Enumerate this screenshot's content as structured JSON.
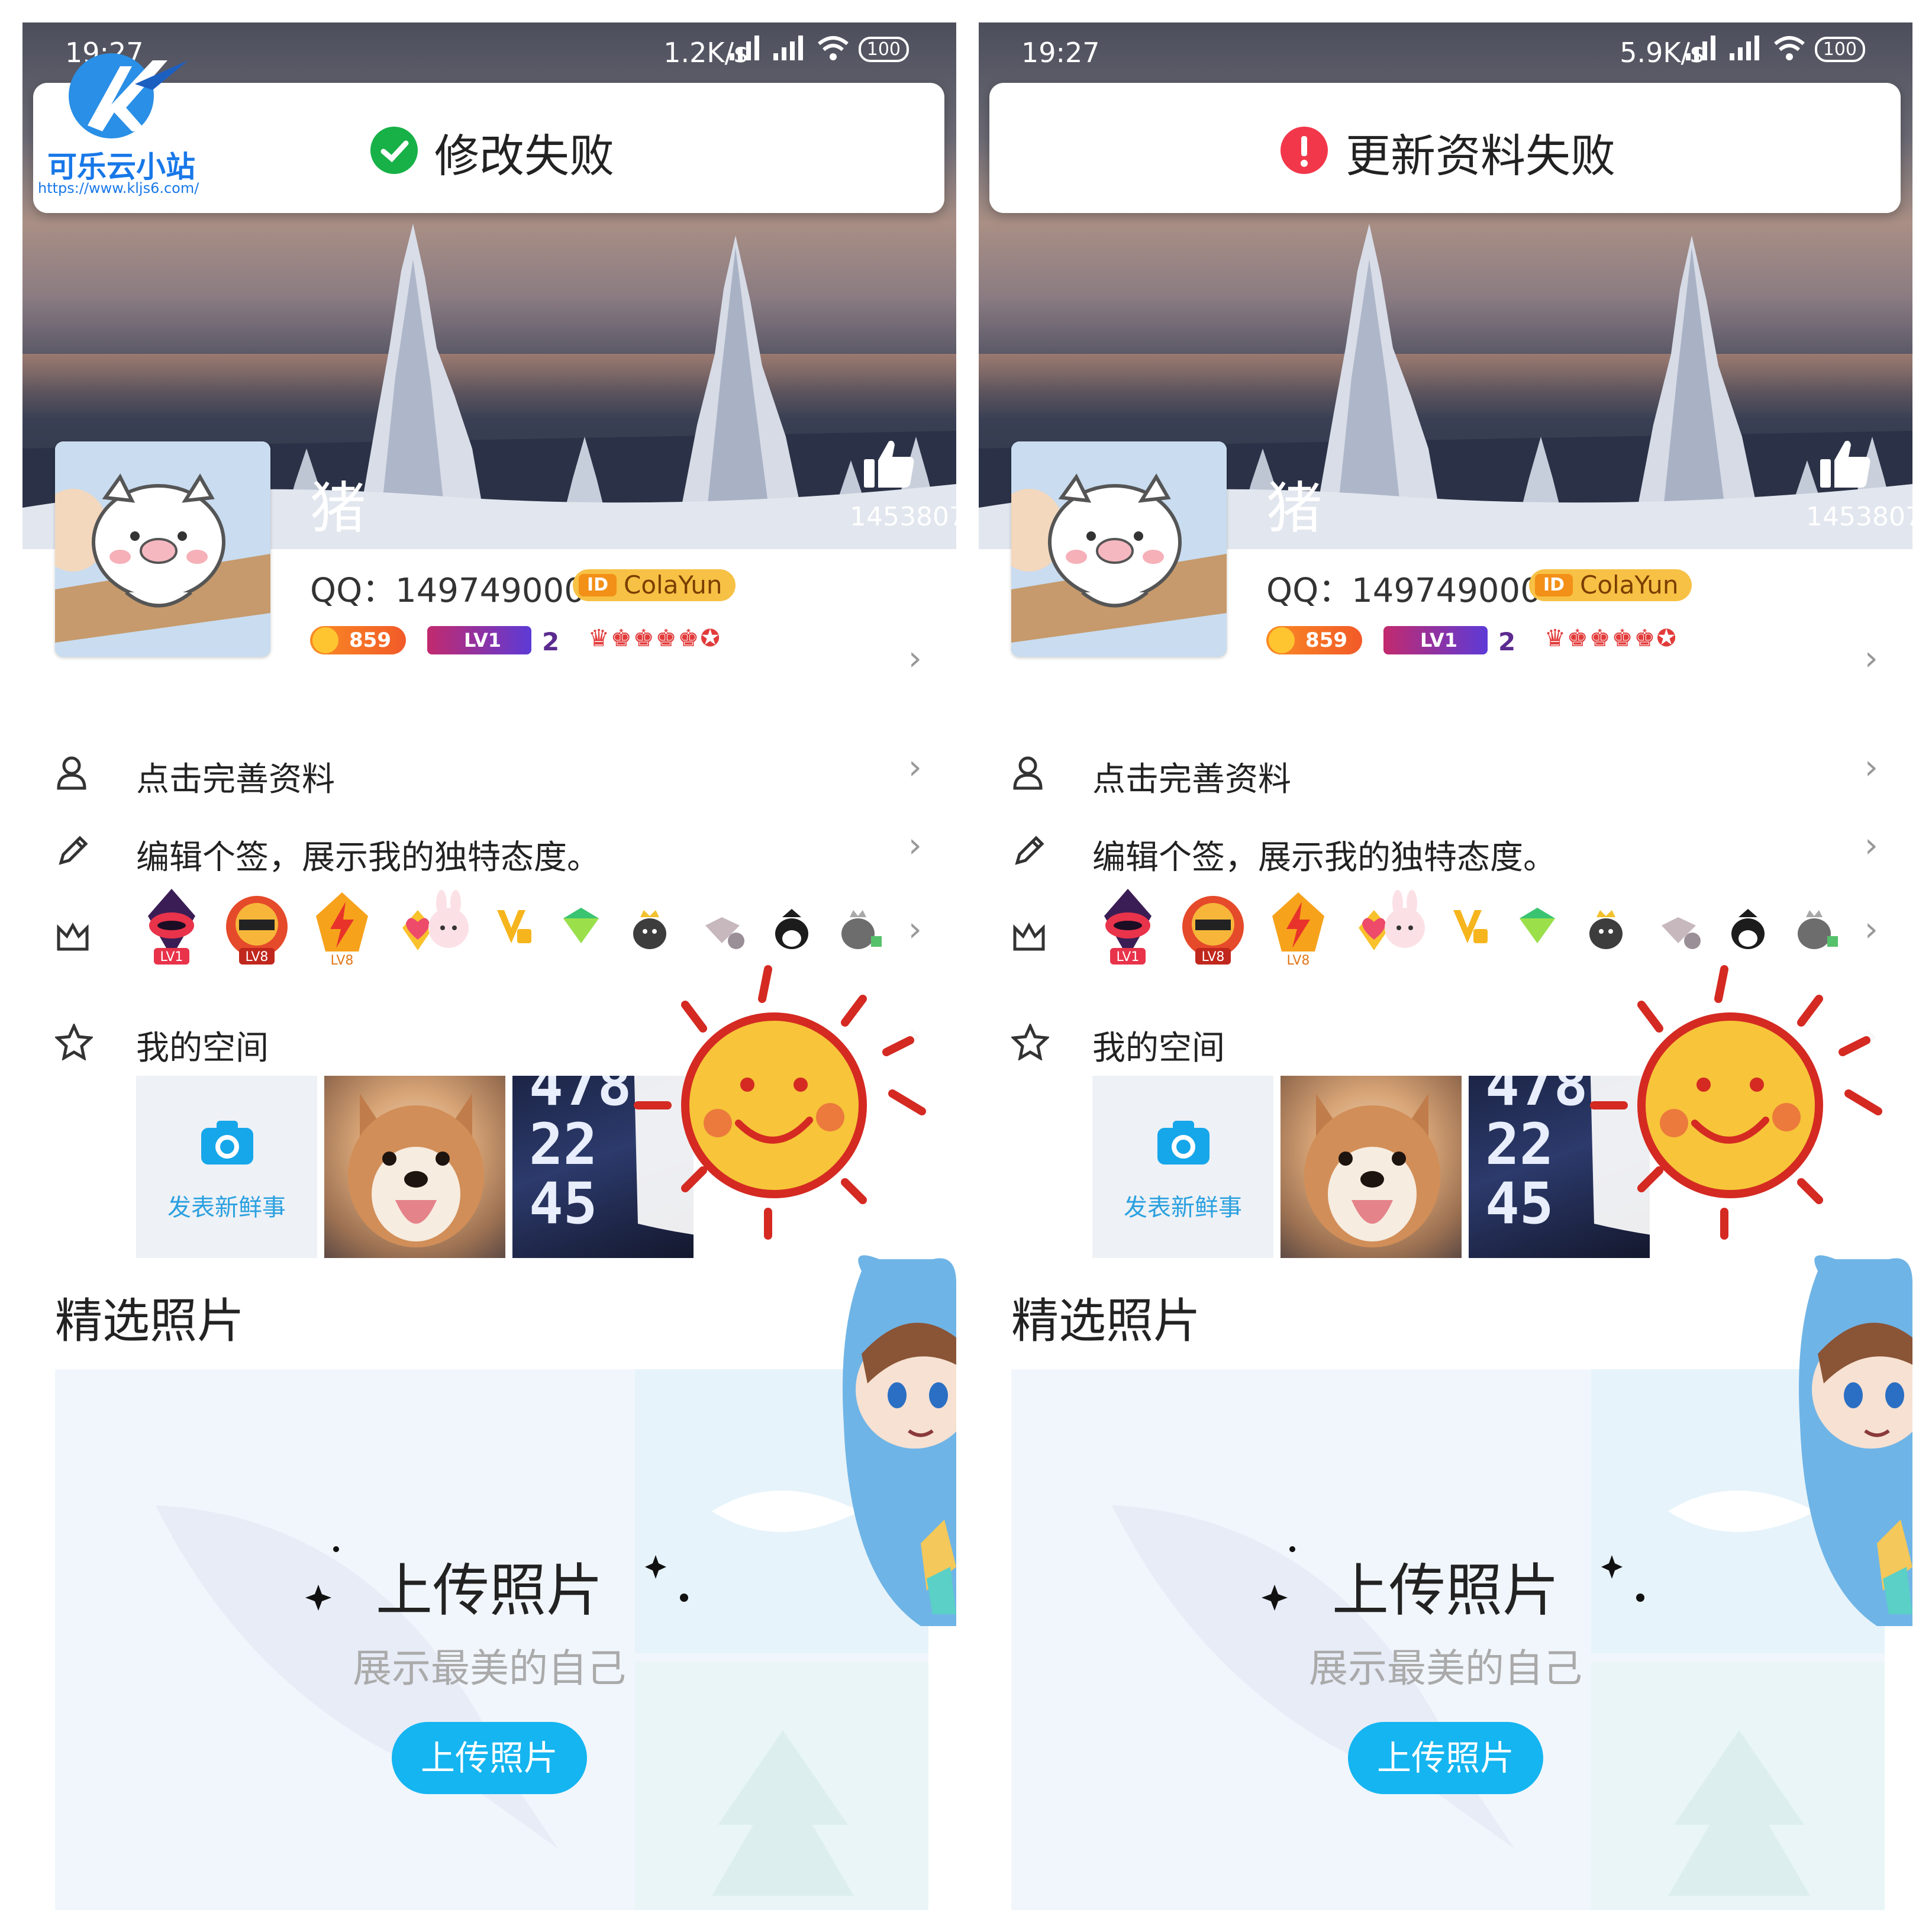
{
  "watermark": {
    "title": "可乐云小站",
    "url": "https://www.kljs6.com/"
  },
  "screens": [
    {
      "status": {
        "time": "19:27",
        "speed": "1.2K/s",
        "battery": "100"
      },
      "toast": {
        "text": "修改失败",
        "icon": "check-circle-icon",
        "color": "#17b147"
      },
      "profile": {
        "nickname": "猪",
        "likes": "1453807",
        "qq": "QQ：149749000",
        "id_tag": "ID",
        "id_name": "ColaYun",
        "coin": "859",
        "level": "LV1",
        "vip": "2"
      },
      "rows": {
        "complete": "点击完善资料",
        "signature": "编辑个签，展示我的独特态度。",
        "space": "我的空间"
      },
      "medal_labels": [
        "LV1",
        "LV8",
        "LV8"
      ],
      "post_label": "发表新鲜事",
      "section_title": "精选照片",
      "upload_title": "上传照片",
      "upload_sub": "展示最美的自己",
      "upload_button": "上传照片"
    },
    {
      "status": {
        "time": "19:27",
        "speed": "5.9K/s",
        "battery": "100"
      },
      "toast": {
        "text": "更新资料失败",
        "icon": "exclamation-circle-icon",
        "color": "#f2374a"
      },
      "profile": {
        "nickname": "猪",
        "likes": "1453807",
        "qq": "QQ：149749000",
        "id_tag": "ID",
        "id_name": "ColaYun",
        "coin": "859",
        "level": "LV1",
        "vip": "2"
      },
      "rows": {
        "complete": "点击完善资料",
        "signature": "编辑个签，展示我的独特态度。",
        "space": "我的空间"
      },
      "medal_labels": [
        "LV1",
        "LV8",
        "LV8"
      ],
      "post_label": "发表新鲜事",
      "section_title": "精选照片",
      "upload_title": "上传照片",
      "upload_sub": "展示最美的自己",
      "upload_button": "上传照片"
    }
  ]
}
